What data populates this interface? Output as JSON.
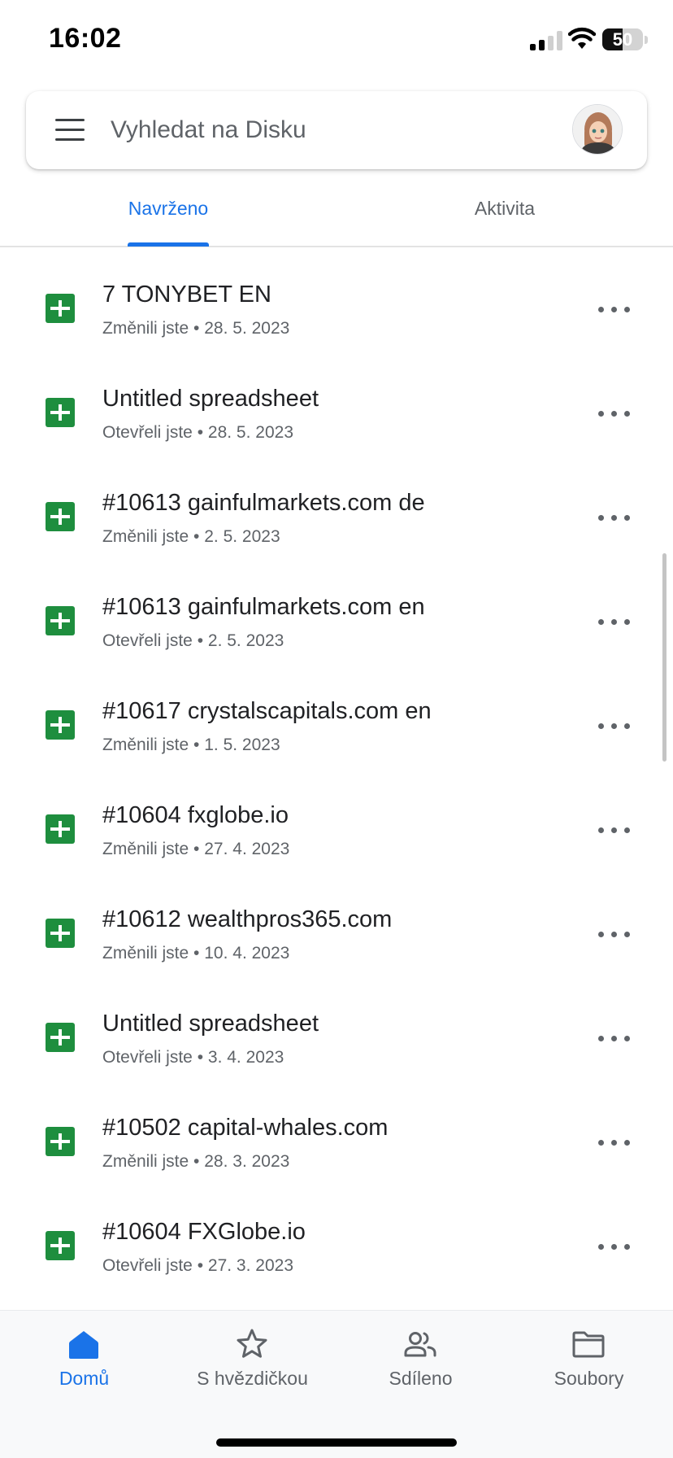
{
  "status_bar": {
    "time": "16:02",
    "battery_level": "50",
    "battery_fraction": 0.5,
    "icons": [
      "cellular-signal-icon",
      "wifi-icon",
      "battery-icon"
    ]
  },
  "search": {
    "placeholder": "Vyhledat na Disku"
  },
  "tabs": [
    {
      "label": "Navrženo",
      "active": true
    },
    {
      "label": "Aktivita",
      "active": false
    }
  ],
  "files": [
    {
      "name": "7 TONYBET EN",
      "action": "Změnili jste",
      "date": "28. 5. 2023",
      "icon": "google-sheets-icon"
    },
    {
      "name": "Untitled spreadsheet",
      "action": "Otevřeli jste",
      "date": "28. 5. 2023",
      "icon": "google-sheets-icon"
    },
    {
      "name": "#10613 gainfulmarkets.com de",
      "action": "Změnili jste",
      "date": "2. 5. 2023",
      "icon": "google-sheets-icon"
    },
    {
      "name": "#10613 gainfulmarkets.com en",
      "action": "Otevřeli jste",
      "date": "2. 5. 2023",
      "icon": "google-sheets-icon"
    },
    {
      "name": "#10617 crystalscapitals.com en",
      "action": "Změnili jste",
      "date": "1. 5. 2023",
      "icon": "google-sheets-icon"
    },
    {
      "name": "#10604 fxglobe.io",
      "action": "Změnili jste",
      "date": "27. 4. 2023",
      "icon": "google-sheets-icon"
    },
    {
      "name": "#10612 wealthpros365.com",
      "action": "Změnili jste",
      "date": "10. 4. 2023",
      "icon": "google-sheets-icon"
    },
    {
      "name": "Untitled spreadsheet",
      "action": "Otevřeli jste",
      "date": "3. 4. 2023",
      "icon": "google-sheets-icon"
    },
    {
      "name": "#10502 capital-whales.com",
      "action": "Změnili jste",
      "date": "28. 3. 2023",
      "icon": "google-sheets-icon"
    },
    {
      "name": "#10604 FXGlobe.io",
      "action": "Otevřeli jste",
      "date": "27. 3. 2023",
      "icon": "google-sheets-icon"
    }
  ],
  "bottom_nav": [
    {
      "label": "Domů",
      "icon": "home-icon",
      "active": true
    },
    {
      "label": "S hvězdičkou",
      "icon": "star-icon",
      "active": false
    },
    {
      "label": "Sdíleno",
      "icon": "people-icon",
      "active": false
    },
    {
      "label": "Soubory",
      "icon": "folder-icon",
      "active": false
    }
  ],
  "colors": {
    "accent": "#1a73e8",
    "sheets_green": "#1e8e3e",
    "text_primary": "#202124",
    "text_secondary": "#5f6368"
  }
}
